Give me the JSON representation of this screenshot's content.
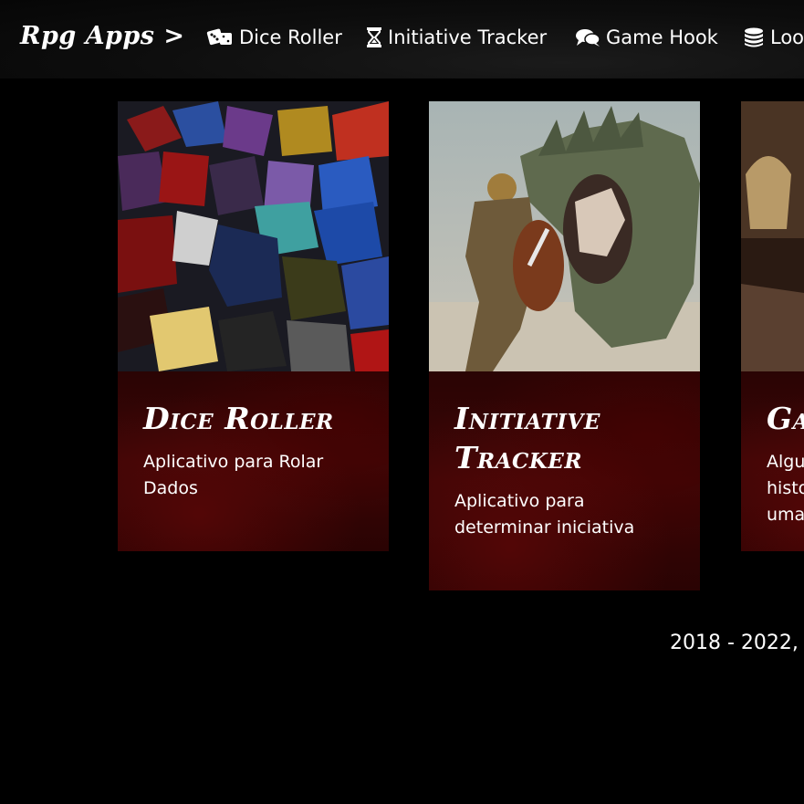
{
  "nav": {
    "brand": "Rpg Apps >",
    "items": [
      {
        "label": "Dice Roller",
        "icon": "dice-icon"
      },
      {
        "label": "Initiative Tracker",
        "icon": "hourglass-icon"
      },
      {
        "label": "Game Hook",
        "icon": "comments-icon"
      },
      {
        "label": "Loo",
        "icon": "coins-icon"
      }
    ]
  },
  "cards": [
    {
      "title": "Dice Roller",
      "text": "Aplicativo para Rolar Dados",
      "image": "dice-photo"
    },
    {
      "title": "Initiative Tracker",
      "text": "Aplicativo para determinar iniciativa",
      "image": "knight-vs-dragon-illustration"
    },
    {
      "title": "Ga",
      "text": "Algu histo uma",
      "image": "tavern-photo"
    }
  ],
  "footer": {
    "text": "2018 - 2022,"
  },
  "colors": {
    "background": "#000000",
    "card_body": "#3a0606",
    "text": "#ffffff"
  }
}
